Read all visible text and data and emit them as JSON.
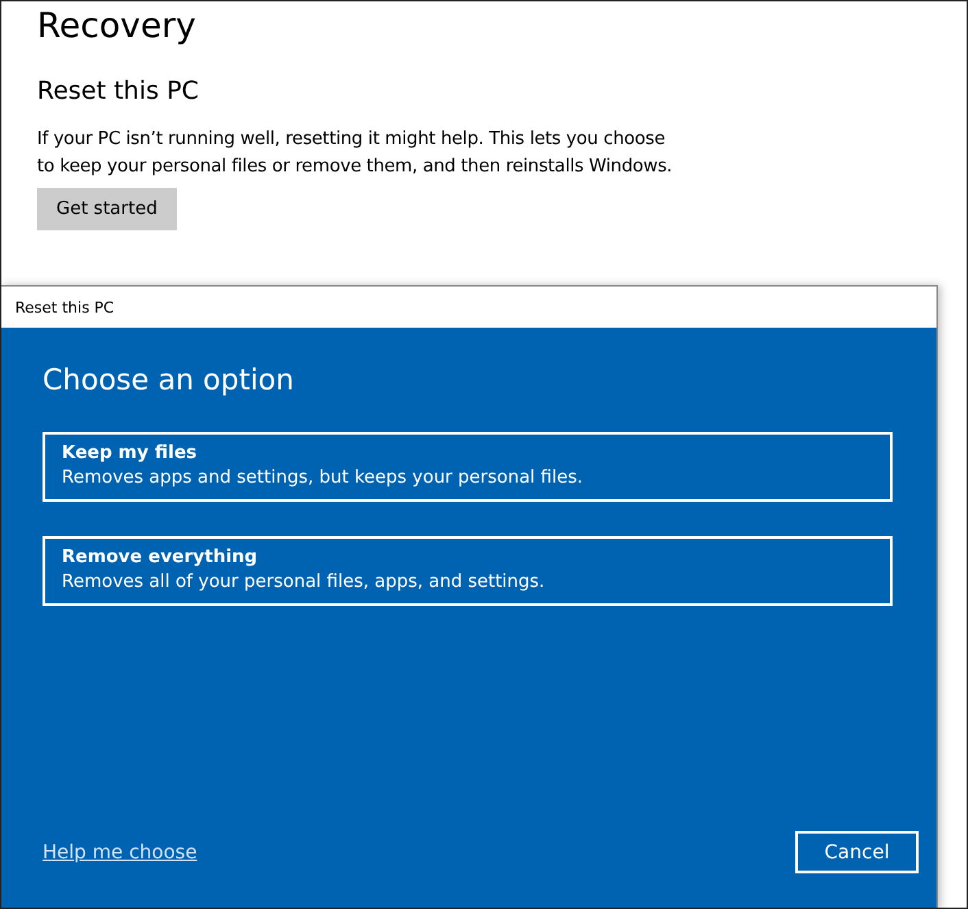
{
  "settings": {
    "title": "Recovery",
    "section_title": "Reset this PC",
    "description": "If your PC isn’t running well, resetting it might help. This lets you choose to keep your personal files or remove them, and then reinstalls Windows.",
    "button": "Get started"
  },
  "dialog": {
    "title": "Reset this PC",
    "heading": "Choose an option",
    "options": [
      {
        "title": "Keep my files",
        "description": "Removes apps and settings, but keeps your personal files."
      },
      {
        "title": "Remove everything",
        "description": "Removes all of your personal files, apps, and settings."
      }
    ],
    "help_link": "Help me choose",
    "cancel_button": "Cancel"
  }
}
